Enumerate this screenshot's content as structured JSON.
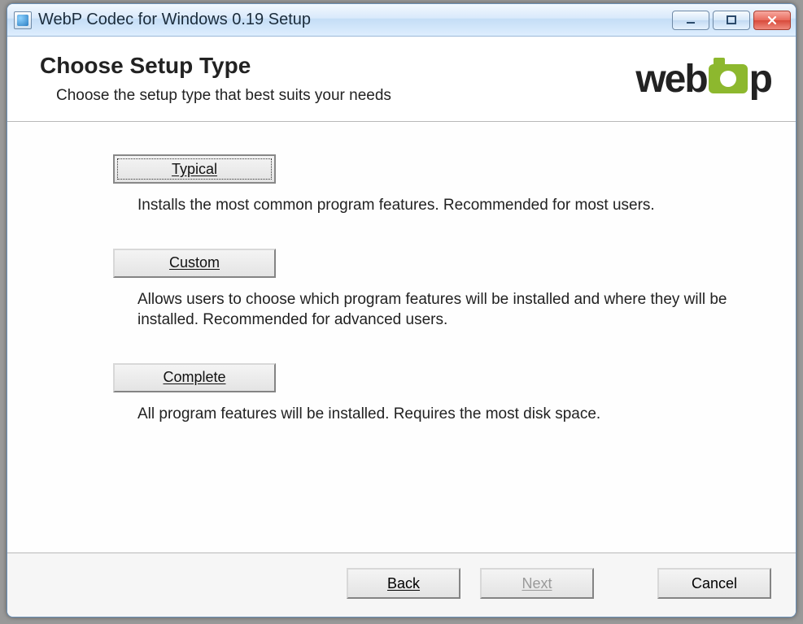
{
  "window": {
    "title": "WebP Codec for Windows 0.19 Setup"
  },
  "header": {
    "title": "Choose Setup Type",
    "subtitle": "Choose the setup type that best suits your needs",
    "logo_text_left": "web",
    "logo_text_right": "p"
  },
  "options": {
    "typical": {
      "label": "Typical",
      "description": "Installs the most common program features. Recommended for most users."
    },
    "custom": {
      "label": "Custom",
      "description": "Allows users to choose which program features will be installed and where they will be installed. Recommended for advanced users."
    },
    "complete": {
      "label": "Complete",
      "description": "All program features will be installed. Requires the most disk space."
    }
  },
  "footer": {
    "back": "Back",
    "next": "Next",
    "cancel": "Cancel"
  }
}
